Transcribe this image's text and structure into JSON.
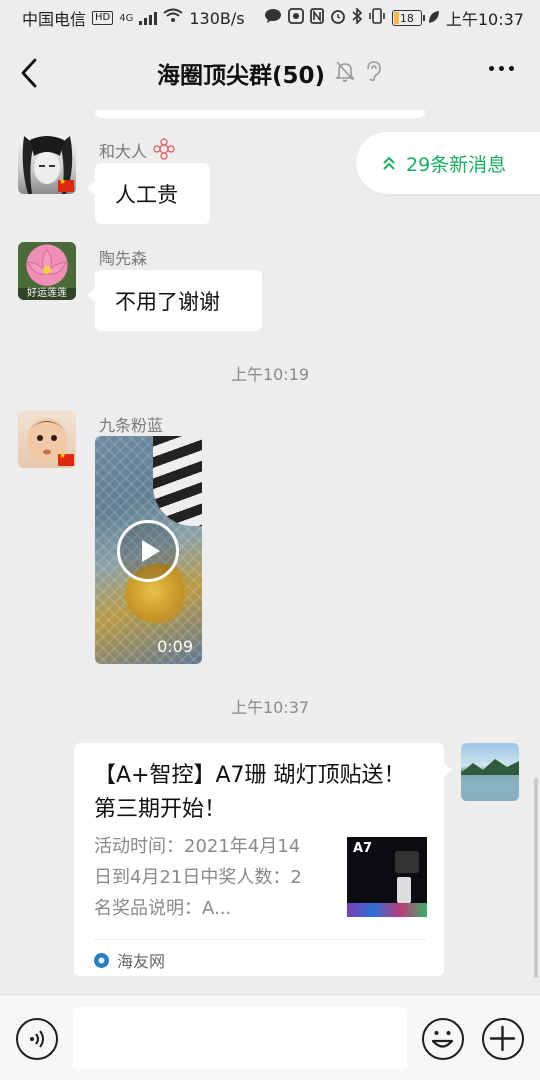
{
  "status_bar": {
    "carrier": "中国电信",
    "hd_label": "HD",
    "network": "4G",
    "speed": "130B/s",
    "battery": "18",
    "battery_fraction": 0.18,
    "time": "上午10:37",
    "icons": [
      "signal-icon",
      "wifi-icon",
      "chat-bubble-icon",
      "app-badge-icon",
      "nfc-icon",
      "alarm-icon",
      "bluetooth-icon",
      "vibrate-icon",
      "battery-icon",
      "leaf-icon"
    ]
  },
  "header": {
    "title": "海圈顶尖群(50)",
    "icons": [
      "back-icon",
      "mute-bell-icon",
      "earpiece-icon",
      "more-icon"
    ]
  },
  "new_messages": {
    "label": "29条新消息",
    "icon": "double-chevron-up-icon",
    "color": "#1aad5f"
  },
  "messages": [
    {
      "sender": "和大人",
      "text": "人工贵",
      "badge_icon": "flower-badge-icon"
    },
    {
      "sender": "陶先森",
      "text": "不用了谢谢",
      "avatar_caption": "好运莲莲"
    },
    {
      "time": "上午10:19"
    },
    {
      "sender": "九条粉蓝",
      "type": "video",
      "duration": "0:09"
    },
    {
      "time": "上午10:37"
    },
    {
      "type": "link_card",
      "title": "【A+智控】A7珊 瑚灯顶贴送！ 第三期开始！",
      "description": "活动时间：2021年4月14日到4月21日中奖人数：2名奖品说明：A...",
      "thumb_label": "A7",
      "source": "海友网"
    }
  ],
  "input_bar": {
    "text_value": "",
    "icons": [
      "voice-icon",
      "emoji-icon",
      "plus-icon"
    ]
  }
}
